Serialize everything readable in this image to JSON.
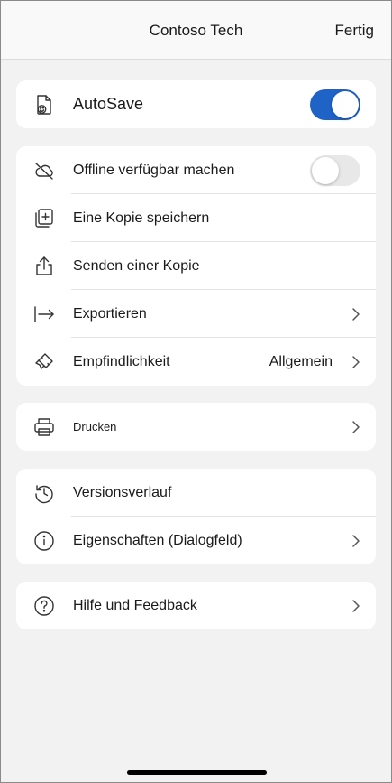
{
  "header": {
    "title": "Contoso Tech",
    "done_label": "Fertig"
  },
  "autosave": {
    "label": "AutoSave",
    "enabled": true
  },
  "file_options": {
    "offline": {
      "label": "Offline verfügbar machen",
      "enabled": false
    },
    "save_copy": {
      "label": "Eine Kopie speichern"
    },
    "send_copy": {
      "label": "Senden einer Kopie"
    },
    "export": {
      "label": "Exportieren"
    },
    "sensitivity": {
      "label": "Empfindlichkeit",
      "value": "Allgemein"
    }
  },
  "print": {
    "label": "Drucken"
  },
  "history": {
    "versions": {
      "label": "Versionsverlauf"
    },
    "properties": {
      "label": "Eigenschaften (Dialogfeld)"
    }
  },
  "help": {
    "label": "Hilfe und Feedback"
  },
  "colors": {
    "toggle_on": "#1f63c6",
    "toggle_off": "#e8e8e8",
    "background": "#f2f2f2",
    "card": "#ffffff"
  }
}
